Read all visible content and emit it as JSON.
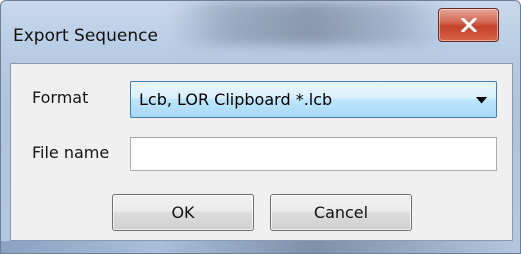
{
  "window": {
    "title": "Export Sequence",
    "close_symbol": "x"
  },
  "form": {
    "format_label": "Format",
    "format_selected": "Lcb, LOR Clipboard *.lcb",
    "filename_label": "File name",
    "filename_value": "",
    "filename_placeholder": ""
  },
  "buttons": {
    "ok_label": "OK",
    "cancel_label": "Cancel"
  },
  "icons": {
    "close": "close-icon",
    "dropdown": "chevron-down-icon"
  },
  "colors": {
    "close_button": "#c4412a",
    "combo_border": "#3c7fb1",
    "combo_fill": "#bee6fd",
    "dialog_background": "#f0f0f0"
  }
}
